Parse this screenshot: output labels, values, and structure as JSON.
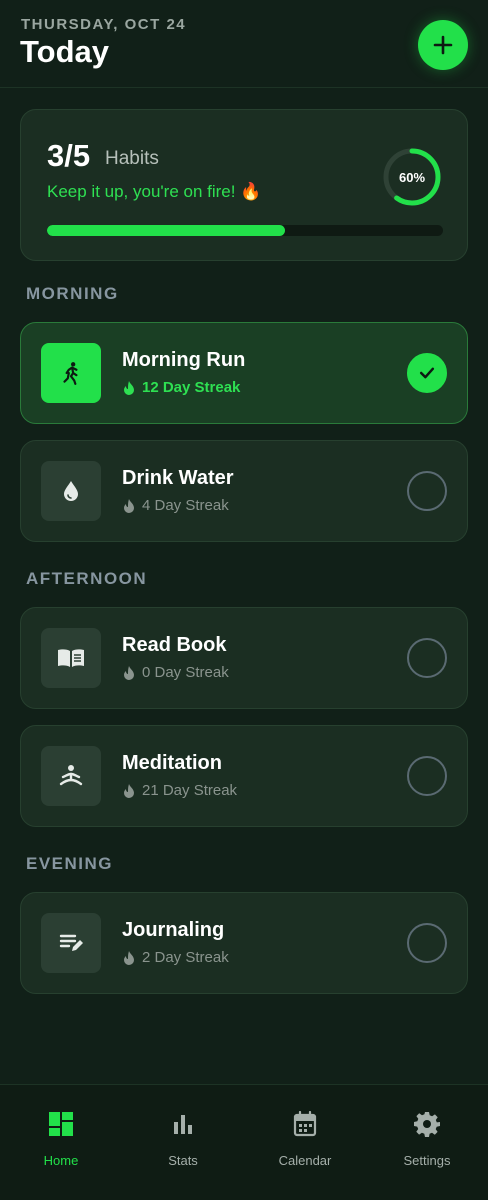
{
  "header": {
    "date": "THURSDAY, OCT 24",
    "title": "Today",
    "add_icon": "plus-icon"
  },
  "summary": {
    "count": "3/5",
    "count_label": "Habits",
    "motto": "Keep it up, you're on fire! 🔥",
    "percent_label": "60%",
    "progress": 0.6
  },
  "sections": {
    "morning": "MORNING",
    "afternoon": "AFTERNOON",
    "evening": "EVENING"
  },
  "habits": [
    {
      "name": "Morning Run",
      "streak": "12 Day Streak",
      "done": true,
      "icon": "running-icon"
    },
    {
      "name": "Drink Water",
      "streak": "4 Day Streak",
      "done": false,
      "icon": "water-drop-icon"
    },
    {
      "name": "Read Book",
      "streak": "0 Day Streak",
      "done": false,
      "icon": "book-icon"
    },
    {
      "name": "Meditation",
      "streak": "21 Day Streak",
      "done": false,
      "icon": "meditation-icon"
    },
    {
      "name": "Journaling",
      "streak": "2 Day Streak",
      "done": false,
      "icon": "journal-icon"
    }
  ],
  "nav": [
    {
      "label": "Home",
      "icon": "dashboard-icon",
      "active": true
    },
    {
      "label": "Stats",
      "icon": "bar-chart-icon",
      "active": false
    },
    {
      "label": "Calendar",
      "icon": "calendar-icon",
      "active": false
    },
    {
      "label": "Settings",
      "icon": "gear-icon",
      "active": false
    }
  ],
  "colors": {
    "accent": "#22e04a",
    "background": "#112018",
    "card": "#1b2e22",
    "muted": "#8a948e"
  }
}
